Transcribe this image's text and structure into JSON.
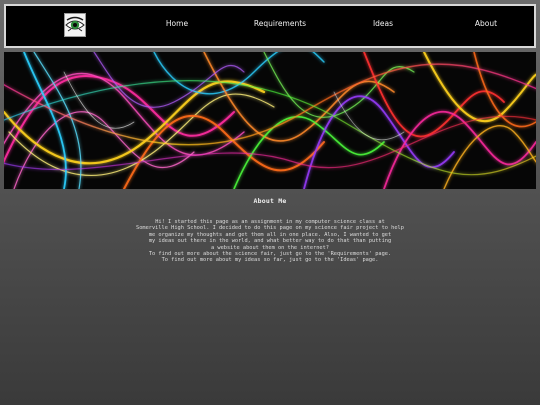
{
  "nav": {
    "logo_icon": "eye-logo-icon",
    "links": [
      {
        "label": "Home"
      },
      {
        "label": "Requirements"
      },
      {
        "label": "Ideas"
      },
      {
        "label": "About"
      }
    ]
  },
  "banner": {
    "image": "colorful-light-streaks-banner",
    "colors": [
      "#ff2aa0",
      "#ffd21c",
      "#2ad0ff",
      "#ff6a1a",
      "#9a3cff",
      "#4cff3c",
      "#ff3030",
      "#ffffff"
    ]
  },
  "about": {
    "title": "About Me",
    "lines": [
      "Hi! I started this page as an assignment in my computer science class at",
      "Somerville High School. I decided to do this page on my science fair project to help",
      "me organize my thoughts and get them all in one place. Also, I wanted to get",
      "my ideas out there in the world, and what better way to do that than putting",
      "a website about them on the internet?",
      "To find out more about the science fair, just go to the 'Requirements' page.",
      "To find out more about my ideas so far, just go to the 'Ideas' page."
    ]
  },
  "theme": {
    "nav_bg": "#000000",
    "nav_border": "#d8d8d8",
    "page_bg_top": "#6c6c6c",
    "page_bg_bottom": "#3a3a3a",
    "text": "#e8e8e8"
  }
}
